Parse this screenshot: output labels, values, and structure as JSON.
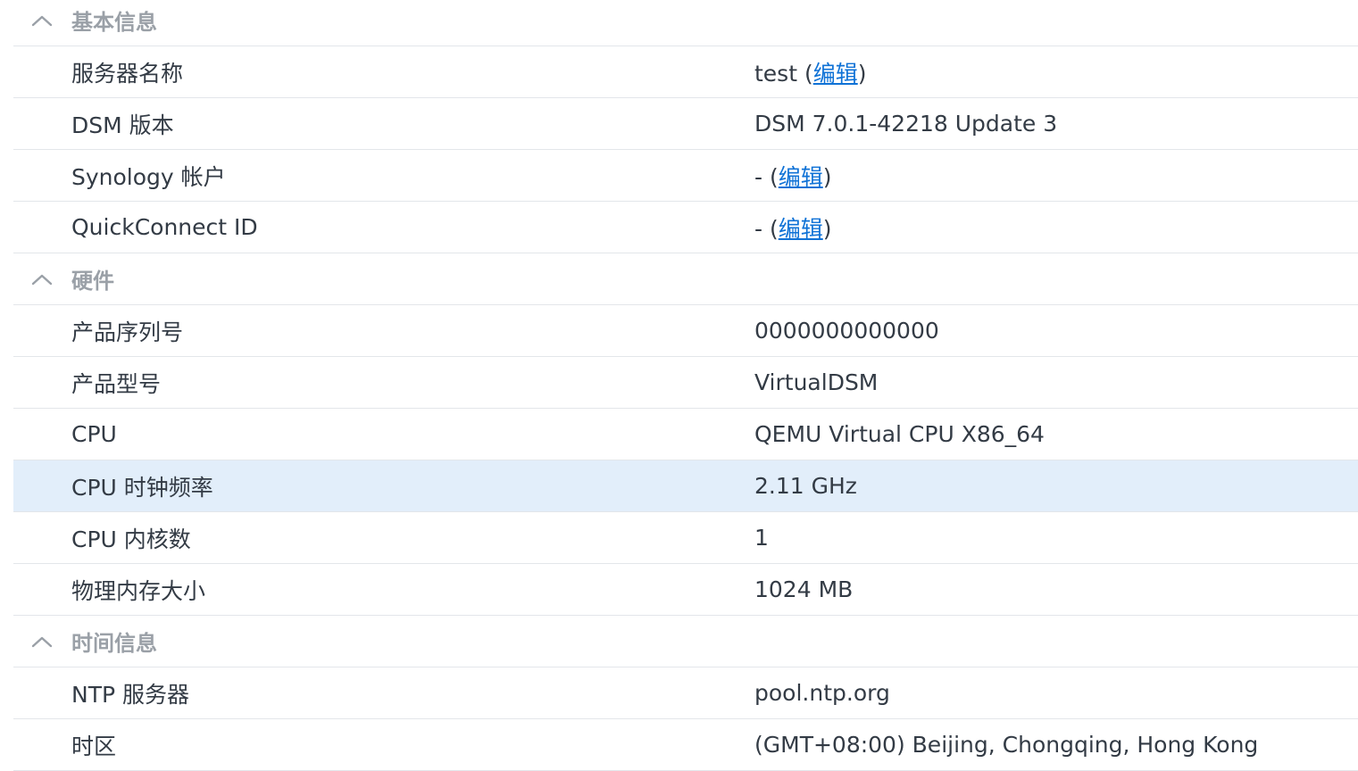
{
  "sections": {
    "basic": {
      "title": "基本信息",
      "server_name": {
        "label": "服务器名称",
        "value": "test",
        "edit": "编辑"
      },
      "dsm_version": {
        "label": "DSM 版本",
        "value": "DSM 7.0.1-42218 Update 3"
      },
      "synology_account": {
        "label": "Synology 帐户",
        "value": "-",
        "edit": "编辑"
      },
      "quickconnect_id": {
        "label": "QuickConnect ID",
        "value": "-",
        "edit": "编辑"
      }
    },
    "hardware": {
      "title": "硬件",
      "serial": {
        "label": "产品序列号",
        "value": "0000000000000"
      },
      "model": {
        "label": "产品型号",
        "value": "VirtualDSM"
      },
      "cpu": {
        "label": "CPU",
        "value": "QEMU Virtual CPU X86_64"
      },
      "cpu_clock": {
        "label": "CPU 时钟频率",
        "value": "2.11 GHz"
      },
      "cpu_cores": {
        "label": "CPU 内核数",
        "value": "1"
      },
      "memory": {
        "label": "物理内存大小",
        "value": "1024 MB"
      }
    },
    "time": {
      "title": "时间信息",
      "ntp_server": {
        "label": "NTP 服务器",
        "value": "pool.ntp.org"
      },
      "timezone": {
        "label": "时区",
        "value": "(GMT+08:00) Beijing, Chongqing, Hong Kong"
      }
    }
  },
  "icons": {
    "section_chevron": "chevron-up-icon"
  },
  "colors": {
    "link": "#0f72d6",
    "selected_row": "#e2eefa",
    "section_title": "#9aa0a7",
    "text": "#333b45",
    "divider": "#e3e6ea"
  }
}
